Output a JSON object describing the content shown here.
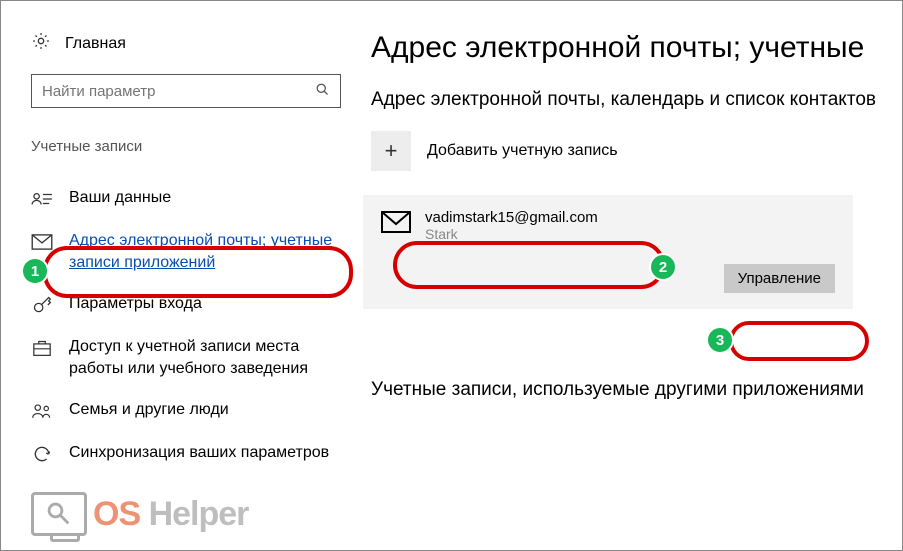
{
  "sidebar": {
    "home": "Главная",
    "search_placeholder": "Найти параметр",
    "section": "Учетные записи",
    "items": [
      {
        "label": "Ваши данные"
      },
      {
        "label": "Адрес электронной почты; учетные записи приложений"
      },
      {
        "label": "Параметры входа"
      },
      {
        "label": "Доступ к учетной записи места работы или учебного заведения"
      },
      {
        "label": "Семья и другие люди"
      },
      {
        "label": "Синхронизация ваших параметров"
      }
    ]
  },
  "main": {
    "title": "Адрес электронной почты; учетные",
    "subheading": "Адрес электронной почты, календарь и список контактов",
    "add_label": "Добавить учетную запись",
    "account": {
      "email": "vadimstark15@gmail.com",
      "name": "Stark"
    },
    "manage_label": "Управление",
    "subheading2": "Учетные записи, используемые другими приложениями"
  },
  "badges": {
    "b1": "1",
    "b2": "2",
    "b3": "3"
  },
  "watermark": {
    "os": "OS",
    "helper": "Helper"
  }
}
